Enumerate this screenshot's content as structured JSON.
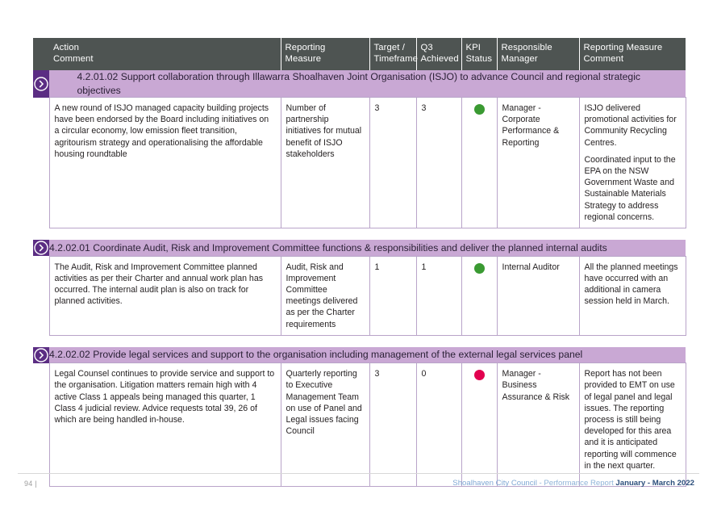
{
  "document": {
    "table_headers": [
      "Action\nComment",
      "Reporting\nMeasure",
      "Target /\nTimeframe",
      "Q3\nAchieved",
      "KPI\nStatus",
      "Responsible\nManager",
      "Reporting Measure\nComment"
    ],
    "header_cells": {
      "action_comment_line1": "Action",
      "action_comment_line2": "Comment",
      "reporting_measure_line1": "Reporting",
      "reporting_measure_line2": "Measure",
      "target_line1": "Target /",
      "target_line2": "Timeframe",
      "q3_line1": "Q3",
      "q3_line2": "Achieved",
      "kpi_line1": "KPI",
      "kpi_line2": "Status",
      "manager_line1": "Responsible",
      "manager_line2": "Manager",
      "rm_comment_line1": "Reporting Measure",
      "rm_comment_line2": "Comment"
    },
    "sections": [
      {
        "id": "4.2.01.02",
        "banner": "4.2.01.02 Support collaboration through Illawarra Shoalhaven Joint Organisation (ISJO) to advance Council and regional strategic objectives",
        "banner_icon": "chevron-right-circle-icon",
        "action_comment": "A new round of ISJO managed capacity building projects have been endorsed by the Board including initiatives on a circular economy, low emission fleet transition, agritourism strategy and operationalising the affordable housing roundtable",
        "reporting_measure": "Number of partnership initiatives for mutual benefit of ISJO stakeholders",
        "target": "3",
        "achieved": "3",
        "kpi_status": "green",
        "kpi_status_color": "#3a9a32",
        "responsible_manager": "Manager - Corporate Performance & Reporting",
        "reporting_measure_comment_p1": "ISJO delivered promotional activities for Community Recycling Centres.",
        "reporting_measure_comment_p2": "Coordinated input to the EPA on the NSW Government Waste and Sustainable Materials Strategy to address regional concerns."
      },
      {
        "id": "4.2.02.01",
        "banner": "4.2.02.01 Coordinate Audit, Risk and Improvement Committee functions & responsibilities and deliver the planned internal audits",
        "banner_icon": "chevron-right-circle-icon",
        "action_comment": "The Audit, Risk and Improvement Committee planned activities as per their Charter and annual work plan has occurred. The internal audit plan is also on track for planned activities.",
        "reporting_measure": "Audit, Risk and Improvement Committee meetings delivered as per the Charter requirements",
        "target": "1",
        "achieved": "1",
        "kpi_status": "green",
        "kpi_status_color": "#3a9a32",
        "responsible_manager": "Internal Auditor",
        "reporting_measure_comment_p1": "All the planned meetings have occurred with an additional in camera session held in March.",
        "reporting_measure_comment_p2": ""
      },
      {
        "id": "4.2.02.02",
        "banner": "4.2.02.02 Provide legal services and support to the organisation including management of the external legal services panel",
        "banner_icon": "chevron-right-circle-icon",
        "action_comment": "Legal Counsel continues to provide service and support to the organisation.  Litigation matters remain high with 4 active Class 1 appeals being managed this quarter, 1 Class 4 judicial review.  Advice requests total 39, 26 of which are being handled in-house.",
        "reporting_measure": "Quarterly reporting to Executive Management Team on use of Panel and Legal issues facing Council",
        "target": "3",
        "achieved": "0",
        "kpi_status": "red",
        "kpi_status_color": "#e2004f",
        "responsible_manager": "Manager - Business Assurance & Risk",
        "reporting_measure_comment_p1": "Report has not been provided to EMT on use of legal panel and legal issues.  The reporting process is still being developed for this area and it is anticipated reporting will commence in the next quarter.",
        "reporting_measure_comment_p2": ""
      }
    ]
  },
  "footer": {
    "page_number": "94  |",
    "org": "Shoalhaven City Council",
    "separator": " - ",
    "report_label": "Performance Report ",
    "period": "January - March 2022"
  },
  "colors": {
    "banner_purple": "#c9a8d4",
    "icon_purple": "#5b2d83",
    "header_grey": "#4e5452",
    "cell_border": "#b9a4c9",
    "status_green": "#3a9a32",
    "status_red": "#e2004f",
    "footer_blue": "#7fa8d4"
  }
}
